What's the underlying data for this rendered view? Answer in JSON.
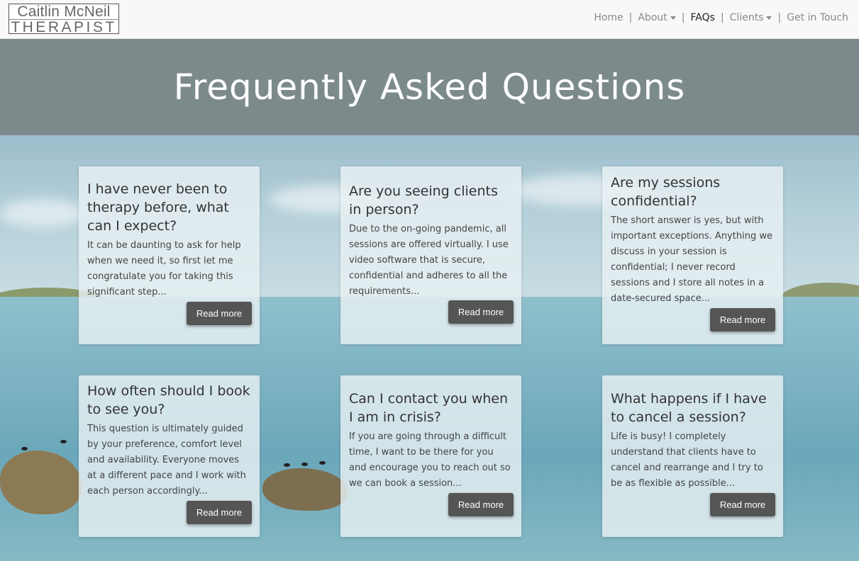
{
  "logo": {
    "line1": "Caitlin McNeil",
    "line2": "THERAPIST"
  },
  "nav": {
    "items": [
      {
        "label": "Home",
        "dropdown": false,
        "active": false
      },
      {
        "label": "About",
        "dropdown": true,
        "active": false
      },
      {
        "label": "FAQs",
        "dropdown": false,
        "active": true
      },
      {
        "label": "Clients",
        "dropdown": true,
        "active": false
      },
      {
        "label": "Get in Touch",
        "dropdown": false,
        "active": false
      }
    ],
    "separator": "|"
  },
  "hero": {
    "title": "Frequently Asked Questions"
  },
  "cards": [
    {
      "title": "I have never been to therapy before, what can I expect?",
      "text": "It can be daunting to ask for help when we need it, so first let me congratulate you for taking this significant step...",
      "button": "Read more"
    },
    {
      "title": "Are you seeing clients in person?",
      "text": "Due to the on-going pandemic, all sessions are offered virtually. I use video software that is secure, confidential and adheres to all the requirements...",
      "button": "Read more"
    },
    {
      "title": "Are my sessions confidential?",
      "text": "The short answer is yes, but with important exceptions. Anything we discuss in your session is confidential; I never record sessions and I store all notes in a date-secured space...",
      "button": "Read more"
    },
    {
      "title": "How often should I book to see you?",
      "text": "This question is ultimately guided by your preference, comfort level and availability. Everyone moves at a different pace and I work with each person accordingly...",
      "button": "Read more"
    },
    {
      "title": "Can I contact you when I am in crisis?",
      "text": "If you are going through a difficult time, I want to be there for you and encourage you to reach out so we can book a session...",
      "button": "Read more"
    },
    {
      "title": "What happens if I have to cancel a session?",
      "text": "Life is busy! I completely understand that clients have to cancel and rearrange and I try to be as flexible as possible...",
      "button": "Read more"
    }
  ],
  "colors": {
    "hero_bg": "#7d8a8c",
    "button_bg": "#555555",
    "nav_bg": "#f8f8f8"
  }
}
